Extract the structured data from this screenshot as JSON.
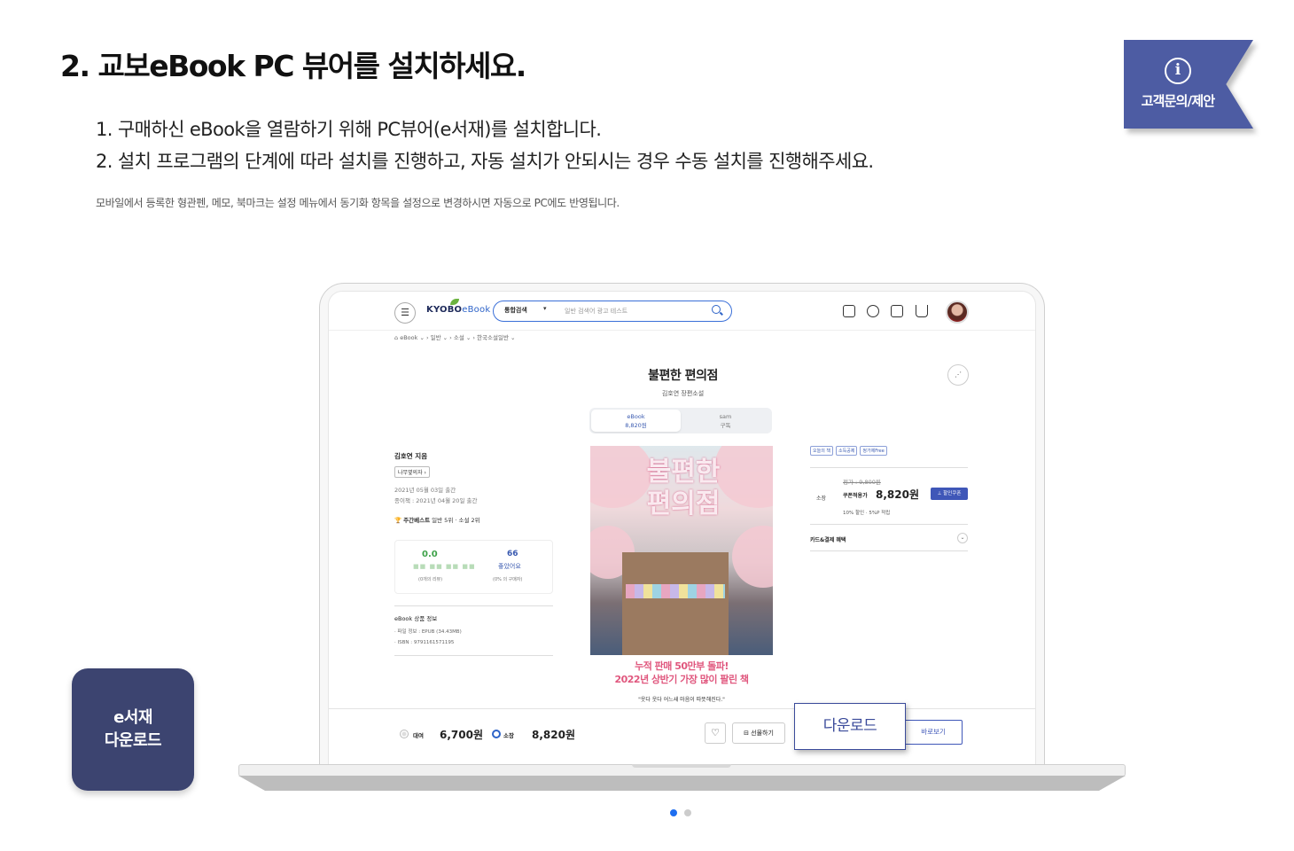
{
  "heading": "2. 교보eBook PC 뷰어를 설치하세요.",
  "steps": [
    "1. 구매하신 eBook을 열람하기 위해 PC뷰어(e서재)를 설치합니다.",
    "2. 설치 프로그램의 단계에 따라 설치를 진행하고, 자동 설치가 안되시는 경우 수동 설치를 진행해주세요."
  ],
  "note": "모바일에서 등록한 형관펜, 메모, 북마크는 설정 메뉴에서 동기화 항목을 설정으로 변경하시면 자동으로 PC에도 반영됩니다.",
  "support": {
    "icon": "info-icon",
    "label": "고객문의/제안",
    "color": "#4d5ca3"
  },
  "elib_button": {
    "line1": "e서재",
    "line2": "다운로드",
    "color": "#3c4470"
  },
  "screen": {
    "brand": "KYOBO",
    "brand_suffix": "eBook",
    "search": {
      "scope": "통합검색",
      "placeholder": "일반 검색어 광고 테스트"
    },
    "breadcrumb": "eBook ⌄  ›  일반 ⌄  ›  소설 ⌄  ›  한국소설일반 ⌄",
    "title": "불편한 편의점",
    "subtitle": "김호연 장편소설",
    "tabs": [
      {
        "name": "eBook",
        "price": "8,820원"
      },
      {
        "name": "sam",
        "price": "구독"
      }
    ],
    "cover": {
      "title": "불편한 편의점",
      "caption1": "누적 판매 50만부 돌파!",
      "caption2": "2022년 상반기 가장 많이 팔린 책",
      "caption3": "\"웃다 웃다 어느새 마음이 따뜻해진다.\""
    },
    "author": "김호연 지음",
    "publisher": "나무옆의자 ›",
    "pubdates": [
      "2021년 05월 03일 출간",
      "종이책 : 2021년 04월 20일 출간"
    ],
    "bestseller": {
      "label": "주간베스트",
      "detail": "일반 5위 · 소설 2위"
    },
    "review": {
      "rating": "0.0",
      "stars": "■■ ■■ ■■ ■■",
      "count": "(0개의 리뷰)",
      "quote": "66",
      "good_label": "좋았어요",
      "good_count": "(0% 의 구매자)"
    },
    "info": {
      "title": "eBook 상품 정보",
      "file": "· 파일 정보 : EPUB (34.43MB)",
      "isbn": "· ISBN : 9791161571195"
    },
    "badges": [
      "오늘의 책",
      "소득공제",
      "정가제Free"
    ],
    "price": {
      "own_label": "소장",
      "list": "정가 : 9,800원",
      "coupon_label": "쿠폰적용가",
      "coupon_price": "8,820원",
      "coupon_button": "⊥ 할인쿠폰",
      "discount": "10% 할인  ·  5%P 적립"
    },
    "card_label": "카드&결제 혜택",
    "bottom": {
      "rent_label": "대여",
      "rent_price": "6,700원",
      "own_label": "소장",
      "own_price": "8,820원",
      "gift_label": "⊟ 선물하기",
      "view_label": "바로보기"
    }
  },
  "download_label": "다운로드",
  "pagination": {
    "total": 2,
    "active": 1
  }
}
